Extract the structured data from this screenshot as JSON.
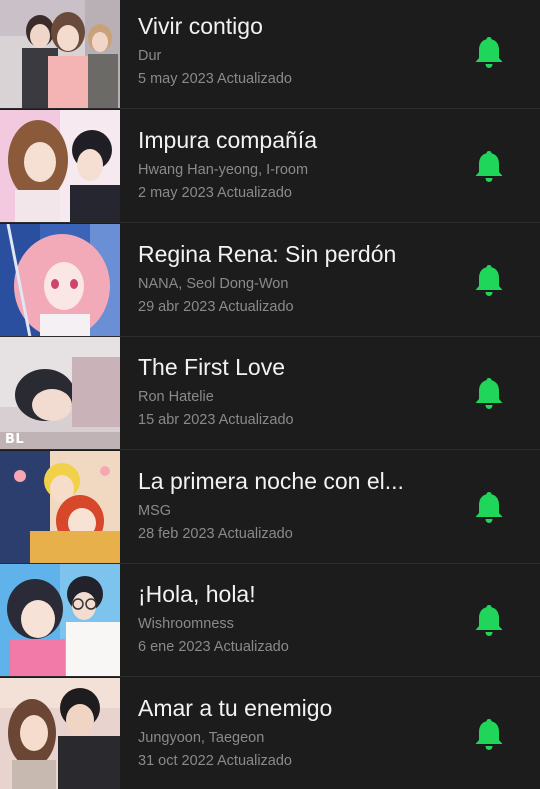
{
  "bell_color": "#1fd65a",
  "items": [
    {
      "title": "Vivir contigo",
      "author": "Dur",
      "updated": "5 may 2023 Actualizado",
      "badge": ""
    },
    {
      "title": "Impura compañía",
      "author": "Hwang Han-yeong, I-room",
      "updated": "2 may 2023 Actualizado",
      "badge": ""
    },
    {
      "title": "Regina Rena: Sin perdón",
      "author": "NANA, Seol Dong-Won",
      "updated": "29 abr 2023 Actualizado",
      "badge": ""
    },
    {
      "title": "The First Love",
      "author": "Ron Hatelie",
      "updated": "15 abr 2023 Actualizado",
      "badge": "BL"
    },
    {
      "title": "La primera noche con el...",
      "author": "MSG",
      "updated": "28 feb 2023 Actualizado",
      "badge": ""
    },
    {
      "title": "¡Hola, hola!",
      "author": "Wishroomness",
      "updated": "6 ene 2023 Actualizado",
      "badge": ""
    },
    {
      "title": "Amar a tu enemigo",
      "author": "Jungyoon, Taegeon",
      "updated": "31 oct 2022 Actualizado",
      "badge": ""
    }
  ]
}
